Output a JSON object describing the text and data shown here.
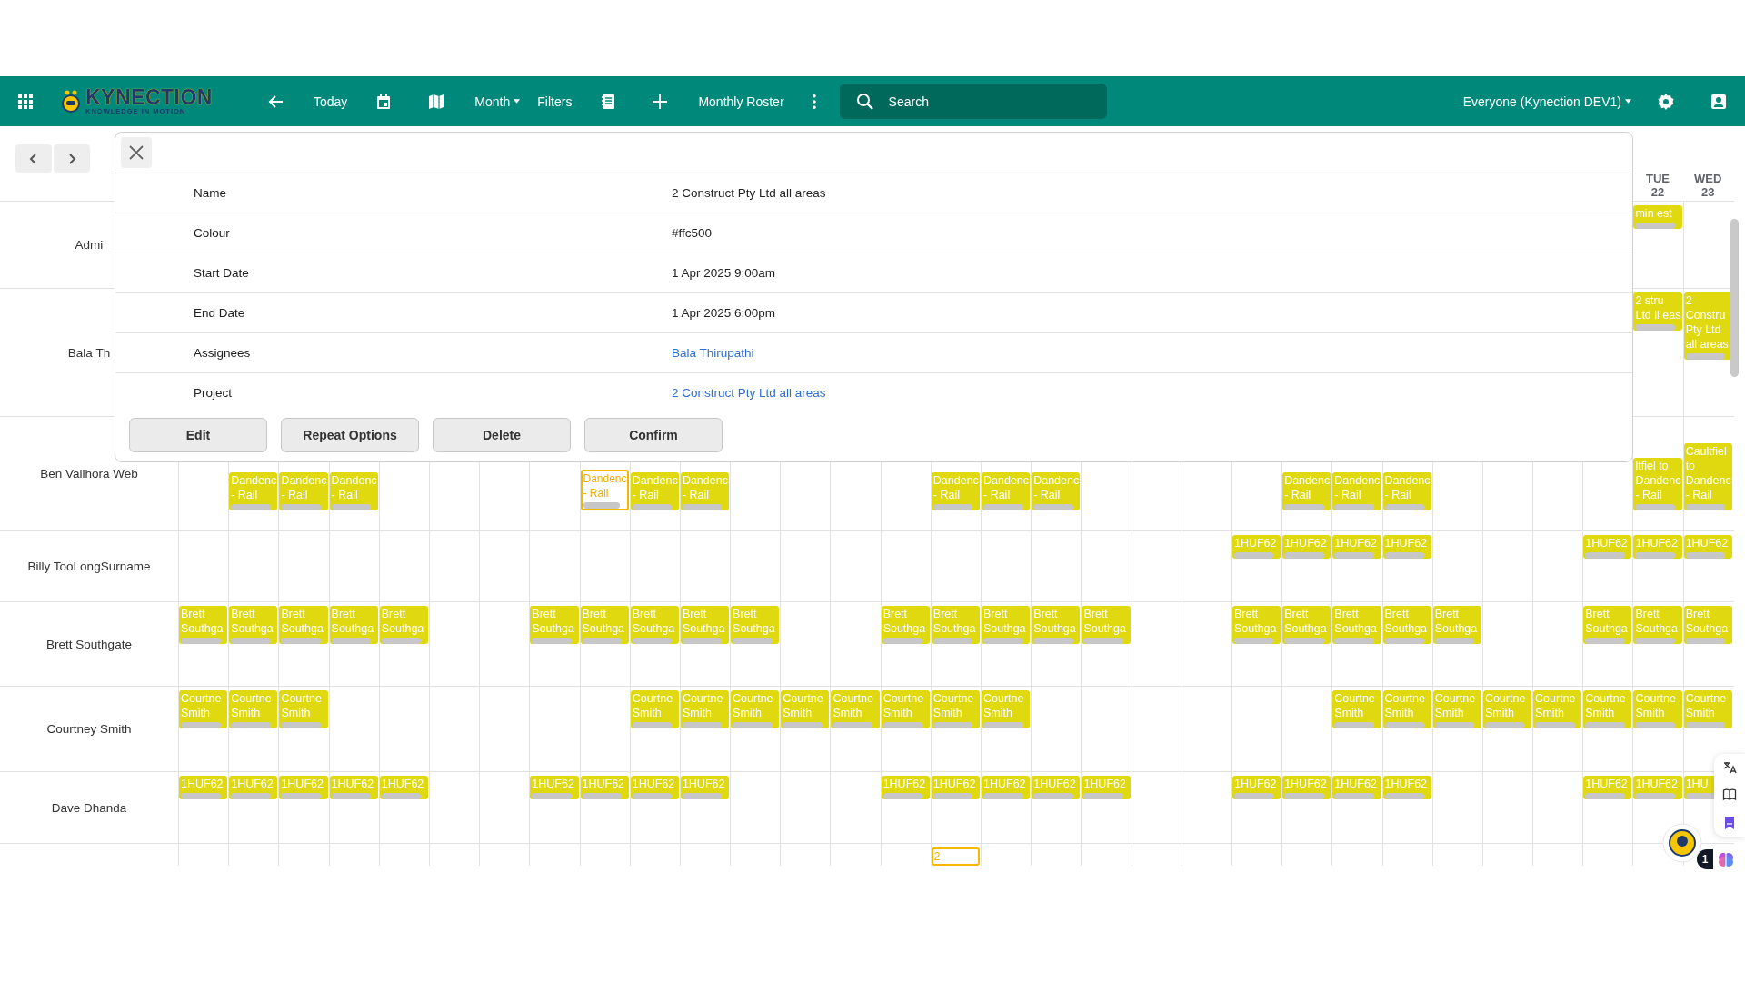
{
  "toolbar": {
    "logo": {
      "name": "KYNECTION",
      "tagline": "KNOWLEDGE IN MOTION"
    },
    "today": "Today",
    "view": "Month",
    "filters": "Filters",
    "roster": "Monthly Roster",
    "search": {
      "placeholder": "Search"
    },
    "scope": "Everyone (Kynection DEV1)"
  },
  "header_cells": [
    {
      "kind": "empty"
    },
    {
      "kind": "empty"
    },
    {
      "kind": "empty"
    },
    {
      "kind": "empty"
    },
    {
      "kind": "empty"
    },
    {
      "kind": "empty"
    },
    {
      "kind": "empty"
    },
    {
      "kind": "empty"
    },
    {
      "kind": "empty"
    },
    {
      "kind": "empty"
    },
    {
      "kind": "empty"
    },
    {
      "kind": "empty"
    },
    {
      "kind": "empty"
    },
    {
      "kind": "empty"
    },
    {
      "kind": "empty"
    },
    {
      "kind": "empty"
    },
    {
      "kind": "empty"
    },
    {
      "kind": "empty"
    },
    {
      "kind": "empty"
    },
    {
      "kind": "empty"
    },
    {
      "kind": "empty"
    },
    {
      "kind": "empty"
    },
    {
      "kind": "empty"
    },
    {
      "kind": "empty"
    },
    {
      "kind": "empty"
    },
    {
      "kind": "empty"
    },
    {
      "kind": "empty"
    },
    {
      "kind": "empty"
    },
    {
      "kind": "empty"
    },
    {
      "kind": "date",
      "day": "TUE",
      "date": "22"
    },
    {
      "kind": "date",
      "day": "WED",
      "date": "23"
    }
  ],
  "rows": [
    {
      "name": "Admi",
      "cells": [
        {
          "kind": "empty"
        },
        {
          "kind": "empty"
        },
        {
          "kind": "empty"
        },
        {
          "kind": "empty"
        },
        {
          "kind": "empty"
        },
        {
          "kind": "empty"
        },
        {
          "kind": "empty"
        },
        {
          "kind": "empty"
        },
        {
          "kind": "empty"
        },
        {
          "kind": "empty"
        },
        {
          "kind": "empty"
        },
        {
          "kind": "empty"
        },
        {
          "kind": "empty"
        },
        {
          "kind": "empty"
        },
        {
          "kind": "empty"
        },
        {
          "kind": "empty"
        },
        {
          "kind": "empty"
        },
        {
          "kind": "empty"
        },
        {
          "kind": "empty"
        },
        {
          "kind": "empty"
        },
        {
          "kind": "empty"
        },
        {
          "kind": "empty"
        },
        {
          "kind": "empty"
        },
        {
          "kind": "empty"
        },
        {
          "kind": "empty"
        },
        {
          "kind": "empty"
        },
        {
          "kind": "empty"
        },
        {
          "kind": "empty"
        },
        {
          "kind": "empty"
        },
        {
          "kind": "shift",
          "text": "min est",
          "selected": false
        },
        {
          "kind": "empty"
        }
      ]
    },
    {
      "name": "Bala Th",
      "cells": [
        {
          "kind": "empty"
        },
        {
          "kind": "empty"
        },
        {
          "kind": "empty"
        },
        {
          "kind": "empty"
        },
        {
          "kind": "empty"
        },
        {
          "kind": "empty"
        },
        {
          "kind": "empty"
        },
        {
          "kind": "empty"
        },
        {
          "kind": "empty"
        },
        {
          "kind": "empty"
        },
        {
          "kind": "empty"
        },
        {
          "kind": "empty"
        },
        {
          "kind": "empty"
        },
        {
          "kind": "empty"
        },
        {
          "kind": "empty"
        },
        {
          "kind": "empty"
        },
        {
          "kind": "empty"
        },
        {
          "kind": "empty"
        },
        {
          "kind": "empty"
        },
        {
          "kind": "empty"
        },
        {
          "kind": "empty"
        },
        {
          "kind": "empty"
        },
        {
          "kind": "empty"
        },
        {
          "kind": "empty"
        },
        {
          "kind": "empty"
        },
        {
          "kind": "empty"
        },
        {
          "kind": "empty"
        },
        {
          "kind": "empty"
        },
        {
          "kind": "empty"
        },
        {
          "kind": "shift",
          "text": "2 stru Ltd ll eas",
          "selected": false
        },
        {
          "kind": "shift",
          "text": "2 Constru Pty Ltd all areas",
          "selected": false
        }
      ]
    },
    {
      "name": "Ben Valihora Web",
      "cells": [
        {
          "kind": "empty"
        },
        {
          "kind": "shift",
          "text": "Dandenc - Rail",
          "selected": false
        },
        {
          "kind": "shift",
          "text": "Dandenc - Rail",
          "selected": false
        },
        {
          "kind": "shift",
          "text": "Dandenc - Rail",
          "selected": false
        },
        {
          "kind": "empty"
        },
        {
          "kind": "empty"
        },
        {
          "kind": "empty"
        },
        {
          "kind": "empty"
        },
        {
          "kind": "shift",
          "text": "Dandenc - Rail",
          "selected": true
        },
        {
          "kind": "shift",
          "text": "Dandenc - Rail",
          "selected": false
        },
        {
          "kind": "shift",
          "text": "Dandenc - Rail",
          "selected": false
        },
        {
          "kind": "empty"
        },
        {
          "kind": "empty"
        },
        {
          "kind": "empty"
        },
        {
          "kind": "empty"
        },
        {
          "kind": "shift",
          "text": "Dandenc - Rail",
          "selected": false
        },
        {
          "kind": "shift",
          "text": "Dandenc - Rail",
          "selected": false
        },
        {
          "kind": "shift",
          "text": "Dandenc - Rail",
          "selected": false
        },
        {
          "kind": "empty"
        },
        {
          "kind": "empty"
        },
        {
          "kind": "empty"
        },
        {
          "kind": "empty"
        },
        {
          "kind": "shift",
          "text": "Dandenc - Rail",
          "selected": false
        },
        {
          "kind": "shift",
          "text": "Dandenc - Rail",
          "selected": false
        },
        {
          "kind": "shift",
          "text": "Dandenc - Rail",
          "selected": false
        },
        {
          "kind": "empty"
        },
        {
          "kind": "empty"
        },
        {
          "kind": "empty"
        },
        {
          "kind": "empty"
        },
        {
          "kind": "shift",
          "text": "ltfiel to Dandenc - Rail",
          "selected": false
        },
        {
          "kind": "shift",
          "text": "Caultfiel to Dandenc - Rail",
          "selected": false
        }
      ]
    },
    {
      "name": "Billy TooLongSurname",
      "cells": [
        {
          "kind": "empty"
        },
        {
          "kind": "empty"
        },
        {
          "kind": "empty"
        },
        {
          "kind": "empty"
        },
        {
          "kind": "empty"
        },
        {
          "kind": "empty"
        },
        {
          "kind": "empty"
        },
        {
          "kind": "empty"
        },
        {
          "kind": "empty"
        },
        {
          "kind": "empty"
        },
        {
          "kind": "empty"
        },
        {
          "kind": "empty"
        },
        {
          "kind": "empty"
        },
        {
          "kind": "empty"
        },
        {
          "kind": "empty"
        },
        {
          "kind": "empty"
        },
        {
          "kind": "empty"
        },
        {
          "kind": "empty"
        },
        {
          "kind": "empty"
        },
        {
          "kind": "empty"
        },
        {
          "kind": "empty"
        },
        {
          "kind": "shift",
          "text": "1HUF62",
          "selected": false
        },
        {
          "kind": "shift",
          "text": "1HUF62",
          "selected": false
        },
        {
          "kind": "shift",
          "text": "1HUF62",
          "selected": false
        },
        {
          "kind": "shift",
          "text": "1HUF62",
          "selected": false
        },
        {
          "kind": "empty"
        },
        {
          "kind": "empty"
        },
        {
          "kind": "empty"
        },
        {
          "kind": "shift",
          "text": "1HUF62",
          "selected": false
        },
        {
          "kind": "shift",
          "text": "1HUF62",
          "selected": false
        },
        {
          "kind": "shift",
          "text": "1HUF62",
          "selected": false
        }
      ]
    },
    {
      "name": "Brett Southgate",
      "cells": [
        {
          "kind": "shift",
          "text": "Brett Southga",
          "selected": false
        },
        {
          "kind": "shift",
          "text": "Brett Southga",
          "selected": false
        },
        {
          "kind": "shift",
          "text": "Brett Southga",
          "selected": false
        },
        {
          "kind": "shift",
          "text": "Brett Southga",
          "selected": false
        },
        {
          "kind": "shift",
          "text": "Brett Southga",
          "selected": false
        },
        {
          "kind": "empty"
        },
        {
          "kind": "empty"
        },
        {
          "kind": "shift",
          "text": "Brett Southga",
          "selected": false
        },
        {
          "kind": "shift",
          "text": "Brett Southga",
          "selected": false
        },
        {
          "kind": "shift",
          "text": "Brett Southga",
          "selected": false
        },
        {
          "kind": "shift",
          "text": "Brett Southga",
          "selected": false
        },
        {
          "kind": "shift",
          "text": "Brett Southga",
          "selected": false
        },
        {
          "kind": "empty"
        },
        {
          "kind": "empty"
        },
        {
          "kind": "shift",
          "text": "Brett Southga",
          "selected": false
        },
        {
          "kind": "shift",
          "text": "Brett Southga",
          "selected": false
        },
        {
          "kind": "shift",
          "text": "Brett Southga",
          "selected": false
        },
        {
          "kind": "shift",
          "text": "Brett Southga",
          "selected": false
        },
        {
          "kind": "shift",
          "text": "Brett Southga",
          "selected": false
        },
        {
          "kind": "empty"
        },
        {
          "kind": "empty"
        },
        {
          "kind": "shift",
          "text": "Brett Southga",
          "selected": false
        },
        {
          "kind": "shift",
          "text": "Brett Southga",
          "selected": false
        },
        {
          "kind": "shift",
          "text": "Brett Southga",
          "selected": false
        },
        {
          "kind": "shift",
          "text": "Brett Southga",
          "selected": false
        },
        {
          "kind": "shift",
          "text": "Brett Southga",
          "selected": false
        },
        {
          "kind": "empty"
        },
        {
          "kind": "empty"
        },
        {
          "kind": "shift",
          "text": "Brett Southga",
          "selected": false
        },
        {
          "kind": "shift",
          "text": "Brett Southga",
          "selected": false
        },
        {
          "kind": "shift",
          "text": "Brett Southga",
          "selected": false
        }
      ]
    },
    {
      "name": "Courtney Smith",
      "cells": [
        {
          "kind": "shift",
          "text": "Courtne Smith",
          "selected": false
        },
        {
          "kind": "shift",
          "text": "Courtne Smith",
          "selected": false
        },
        {
          "kind": "shift",
          "text": "Courtne Smith",
          "selected": false
        },
        {
          "kind": "empty"
        },
        {
          "kind": "empty"
        },
        {
          "kind": "empty"
        },
        {
          "kind": "empty"
        },
        {
          "kind": "empty"
        },
        {
          "kind": "empty"
        },
        {
          "kind": "shift",
          "text": "Courtne Smith",
          "selected": false
        },
        {
          "kind": "shift",
          "text": "Courtne Smith",
          "selected": false
        },
        {
          "kind": "shift",
          "text": "Courtne Smith",
          "selected": false
        },
        {
          "kind": "shift",
          "text": "Courtne Smith",
          "selected": false
        },
        {
          "kind": "shift",
          "text": "Courtne Smith",
          "selected": false
        },
        {
          "kind": "shift",
          "text": "Courtne Smith",
          "selected": false
        },
        {
          "kind": "shift",
          "text": "Courtne Smith",
          "selected": false
        },
        {
          "kind": "shift",
          "text": "Courtne Smith",
          "selected": false
        },
        {
          "kind": "empty"
        },
        {
          "kind": "empty"
        },
        {
          "kind": "empty"
        },
        {
          "kind": "empty"
        },
        {
          "kind": "empty"
        },
        {
          "kind": "empty"
        },
        {
          "kind": "shift",
          "text": "Courtne Smith",
          "selected": false
        },
        {
          "kind": "shift",
          "text": "Courtne Smith",
          "selected": false
        },
        {
          "kind": "shift",
          "text": "Courtne Smith",
          "selected": false
        },
        {
          "kind": "shift",
          "text": "Courtne Smith",
          "selected": false
        },
        {
          "kind": "shift",
          "text": "Courtne Smith",
          "selected": false
        },
        {
          "kind": "shift",
          "text": "Courtne Smith",
          "selected": false
        },
        {
          "kind": "shift",
          "text": "Courtne Smith",
          "selected": false
        },
        {
          "kind": "shift",
          "text": "Courtne Smith",
          "selected": false
        }
      ]
    },
    {
      "name": "Dave Dhanda",
      "cells": [
        {
          "kind": "shift",
          "text": "1HUF62",
          "selected": false
        },
        {
          "kind": "shift",
          "text": "1HUF62",
          "selected": false
        },
        {
          "kind": "shift",
          "text": "1HUF62",
          "selected": false
        },
        {
          "kind": "shift",
          "text": "1HUF62",
          "selected": false
        },
        {
          "kind": "shift",
          "text": "1HUF62",
          "selected": false
        },
        {
          "kind": "empty"
        },
        {
          "kind": "empty"
        },
        {
          "kind": "shift",
          "text": "1HUF62",
          "selected": false
        },
        {
          "kind": "shift",
          "text": "1HUF62",
          "selected": false
        },
        {
          "kind": "shift",
          "text": "1HUF62",
          "selected": false
        },
        {
          "kind": "shift",
          "text": "1HUF62",
          "selected": false
        },
        {
          "kind": "empty"
        },
        {
          "kind": "empty"
        },
        {
          "kind": "empty"
        },
        {
          "kind": "shift",
          "text": "1HUF62",
          "selected": false
        },
        {
          "kind": "shift",
          "text": "1HUF62",
          "selected": false
        },
        {
          "kind": "shift",
          "text": "1HUF62",
          "selected": false
        },
        {
          "kind": "shift",
          "text": "1HUF62",
          "selected": false
        },
        {
          "kind": "shift",
          "text": "1HUF62",
          "selected": false
        },
        {
          "kind": "empty"
        },
        {
          "kind": "empty"
        },
        {
          "kind": "shift",
          "text": "1HUF62",
          "selected": false
        },
        {
          "kind": "shift",
          "text": "1HUF62",
          "selected": false
        },
        {
          "kind": "shift",
          "text": "1HUF62",
          "selected": false
        },
        {
          "kind": "shift",
          "text": "1HUF62",
          "selected": false
        },
        {
          "kind": "empty"
        },
        {
          "kind": "empty"
        },
        {
          "kind": "empty"
        },
        {
          "kind": "shift",
          "text": "1HUF62",
          "selected": false
        },
        {
          "kind": "shift",
          "text": "1HUF62",
          "selected": false
        },
        {
          "kind": "shift",
          "text": "1HU",
          "selected": false
        }
      ]
    },
    {
      "cells": [
        {
          "kind": "empty"
        },
        {
          "kind": "empty"
        },
        {
          "kind": "empty"
        },
        {
          "kind": "empty"
        },
        {
          "kind": "empty"
        },
        {
          "kind": "empty"
        },
        {
          "kind": "empty"
        },
        {
          "kind": "empty"
        },
        {
          "kind": "empty"
        },
        {
          "kind": "empty"
        },
        {
          "kind": "empty"
        },
        {
          "kind": "empty"
        },
        {
          "kind": "empty"
        },
        {
          "kind": "empty"
        },
        {
          "kind": "empty"
        },
        {
          "kind": "shift",
          "text": "2",
          "selected": true
        },
        {
          "kind": "empty"
        },
        {
          "kind": "empty"
        },
        {
          "kind": "empty"
        },
        {
          "kind": "empty"
        },
        {
          "kind": "empty"
        },
        {
          "kind": "empty"
        },
        {
          "kind": "empty"
        },
        {
          "kind": "empty"
        },
        {
          "kind": "empty"
        },
        {
          "kind": "empty"
        },
        {
          "kind": "empty"
        },
        {
          "kind": "empty"
        },
        {
          "kind": "empty"
        },
        {
          "kind": "empty"
        },
        {
          "kind": "empty"
        }
      ]
    }
  ],
  "dialog": {
    "details": [
      {
        "label": "Name",
        "value": "2 Construct Pty Ltd all areas",
        "kind": "text"
      },
      {
        "label": "Colour",
        "value": "#ffc500",
        "kind": "text"
      },
      {
        "label": "Start Date",
        "value": "1 Apr 2025 9:00am",
        "kind": "text"
      },
      {
        "label": "End Date",
        "value": "1 Apr 2025 6:00pm",
        "kind": "text"
      },
      {
        "label": "Assignees",
        "value": "Bala Thirupathi",
        "kind": "link"
      },
      {
        "label": "Project",
        "value": "2 Construct Pty Ltd all areas",
        "kind": "link"
      }
    ],
    "buttons": [
      "Edit",
      "Repeat Options",
      "Delete",
      "Confirm"
    ]
  },
  "assistant": {
    "badge": "1"
  }
}
